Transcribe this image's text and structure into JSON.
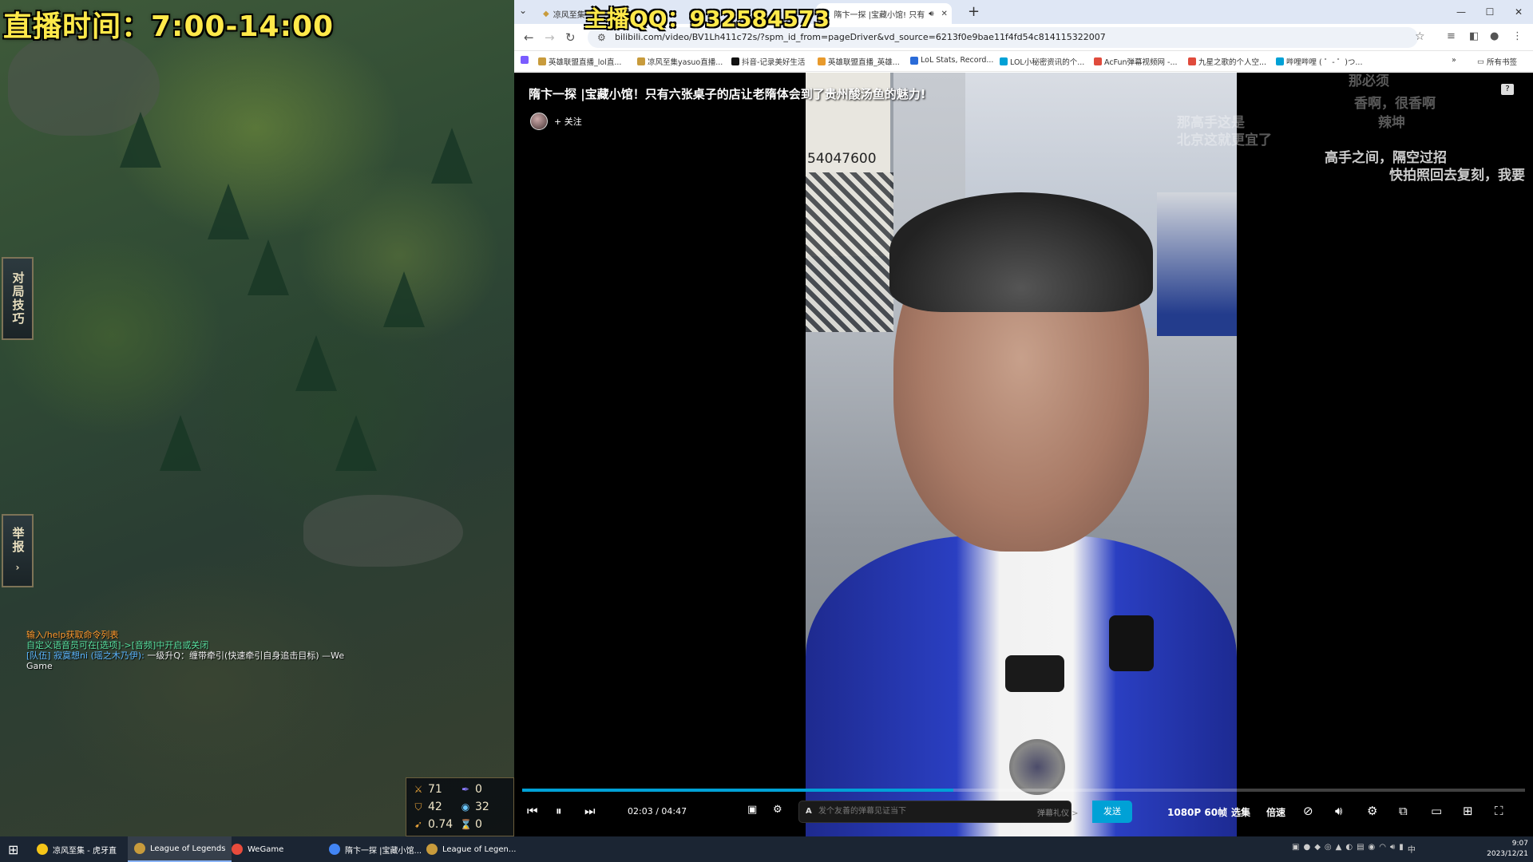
{
  "overlay": {
    "live_time": "直播时间：7:00-14:00",
    "qq": "主播QQ：932584573"
  },
  "game": {
    "tactics_tab": "对局技巧",
    "report_tab": "举报",
    "chat": [
      {
        "text": "输入/help获取命令列表",
        "color": "orange"
      },
      {
        "text": "自定义语音员可在[选项]->[音频]中开启或关闭",
        "color": "green"
      },
      {
        "text_prefix": "[队伍] 寂寞想ni (瑶之木乃伊):",
        "text": " 一级升Q：缠带牵引(快速牵引自身追击目标) —We",
        "color": "blue"
      },
      {
        "text": "Game",
        "color": "white"
      }
    ],
    "stats": {
      "attack": "71",
      "ability_power": "0",
      "armor": "42",
      "magic_resist": "32",
      "attack_speed": "0.74",
      "crit": "0"
    }
  },
  "browser": {
    "tabs": [
      {
        "label": "凉风至集",
        "active": false
      },
      {
        "label": "隋卞一探 |宝藏小馆! 只有",
        "active": true
      }
    ],
    "url": "bilibili.com/video/BV1Lh411c72s/?spm_id_from=pageDriver&vd_source=6213f0e9bae11f4fd54c814115322007",
    "bookmarks": [
      "英雄联盟直播_lol直...",
      "凉风至集yasuo直播...",
      "抖音-记录美好生活",
      "英雄联盟直播_英雄...",
      "LoL Stats, Record...",
      "LOL小秘密资讯的个...",
      "AcFun弹幕视频网 -...",
      "九星之歌的个人空...",
      "哔哩哔哩 ( ゜- ゜)つ..."
    ],
    "bookmarks_all": "所有书签"
  },
  "player": {
    "title": "隋卞一探 |宝藏小馆！只有六张桌子的店让老隋体会到了贵州酸汤鱼的魅力!",
    "follow": "+ 关注",
    "phone_number": "54047600",
    "danmaku": [
      "那必须",
      "香啊，很香啊",
      "辣坤",
      "那高手这是",
      "北京这就更宜了",
      "高手之间，隔空过招",
      "快拍照回去复刻，我要"
    ],
    "time_current": "02:03",
    "time_total": "04:47",
    "time_sep": " / ",
    "progress": 0.43,
    "danmaku_placeholder": "发个友善的弹幕见证当下",
    "etiquette": "弹幕礼仪 >",
    "send": "发送",
    "quality": "1080P 60帧",
    "episodes": "选集",
    "speed": "倍速"
  },
  "taskbar": {
    "items": [
      {
        "label": "凉风至集 - 虎牙直",
        "color": "#f5c518"
      },
      {
        "label": "League of Legends",
        "color": "#c89b3c",
        "active": true
      },
      {
        "label": "WeGame",
        "color": "#e84b3c"
      },
      {
        "label": "隋卞一探 |宝藏小馆...",
        "color": "#4285f4"
      },
      {
        "label": "League of Legen...",
        "color": "#c89b3c"
      }
    ],
    "time": "9:07",
    "date": "2023/12/21"
  },
  "colors": {
    "accent": "#00a1d6",
    "overlay_yellow": "#ffe94a"
  }
}
